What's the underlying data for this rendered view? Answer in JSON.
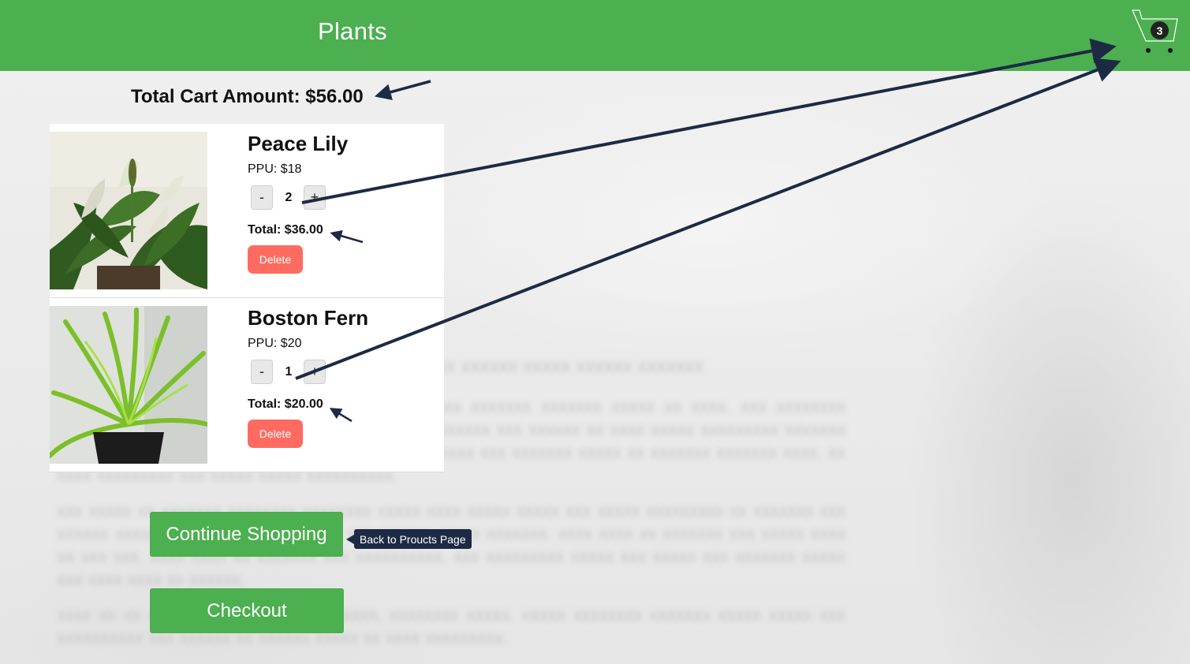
{
  "header": {
    "title": "Plants",
    "cart_count": "3"
  },
  "cart": {
    "total_label": "Total Cart Amount: $56.00",
    "items": [
      {
        "name": "Peace Lily",
        "ppu": "PPU: $18",
        "minus": "-",
        "quantity": "2",
        "plus": "+",
        "total": "Total: $36.00",
        "delete_label": "Delete"
      },
      {
        "name": "Boston Fern",
        "ppu": "PPU: $20",
        "minus": "-",
        "quantity": "1",
        "plus": "+",
        "total": "Total: $20.00",
        "delete_label": "Delete"
      }
    ]
  },
  "actions": {
    "continue_label": "Continue Shopping",
    "checkout_label": "Checkout",
    "tooltip": "Back to Proucts Page"
  },
  "colors": {
    "brand_green": "#4caf50",
    "delete_red": "#ff6b61",
    "annotation_navy": "#1d2a44"
  },
  "icons": {
    "cart": "shopping-cart-icon"
  }
}
